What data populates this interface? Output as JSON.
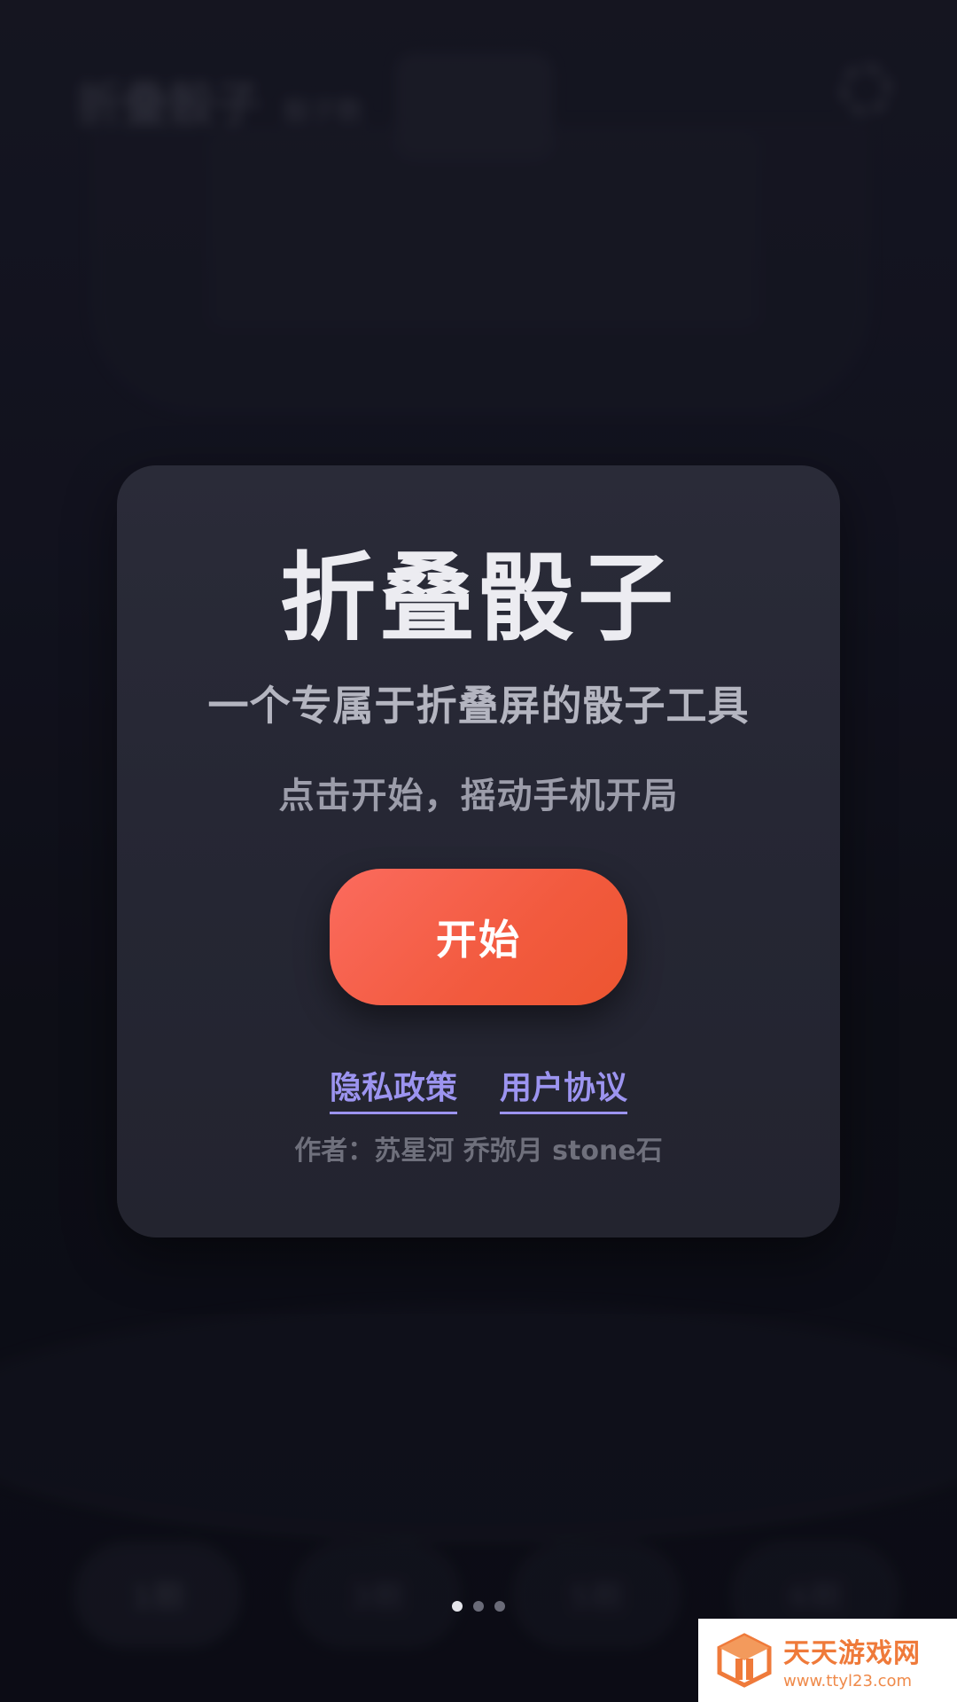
{
  "background_app": {
    "title": "折叠骰子",
    "subtitle": "骰子数",
    "dice_counts": [
      "1颗",
      "3颗",
      "5颗",
      "6颗"
    ]
  },
  "dialog": {
    "title": "折叠骰子",
    "subtitle": "一个专属于折叠屏的骰子工具",
    "hint": "点击开始，摇动手机开局",
    "start_label": "开始",
    "links": {
      "privacy": "隐私政策",
      "agreement": "用户协议"
    },
    "authors": "作者：苏星河 乔弥月 stone石"
  },
  "pager": {
    "total": 3,
    "active_index": 0
  },
  "watermark": {
    "name": "天天游戏网",
    "url": "www.ttyl23.com"
  },
  "colors": {
    "accent": "#f25a3e",
    "link": "#9c94f0",
    "card": "#262734",
    "background": "#141520"
  }
}
